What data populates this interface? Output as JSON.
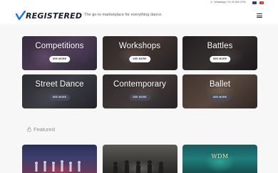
{
  "topbar": {
    "contact": "WhatsApp +41 00 000 3751",
    "languages": [
      "en",
      "de"
    ]
  },
  "header": {
    "logo_text": "REGISTERED",
    "tagline": "The go-to marketplace for everything dance."
  },
  "categories": [
    {
      "title": "Competitions",
      "button": "SEE MORE"
    },
    {
      "title": "Workshops",
      "button": "SEE MORE"
    },
    {
      "title": "Battles",
      "button": "SEE MORE"
    },
    {
      "title": "Street Dance",
      "button": "SEE MORE"
    },
    {
      "title": "Contemporary",
      "button": "SEE MORE"
    },
    {
      "title": "Ballet",
      "button": "SEE MORE"
    }
  ],
  "featured": {
    "title": "Featured",
    "cards": [
      {
        "icon": "group-dancers-stage"
      },
      {
        "icon": "crew-group-photo"
      },
      {
        "text": "WDM"
      }
    ]
  },
  "colors": {
    "accent": "#1a73e8",
    "text": "#1f2430",
    "muted": "#8a8f99"
  }
}
